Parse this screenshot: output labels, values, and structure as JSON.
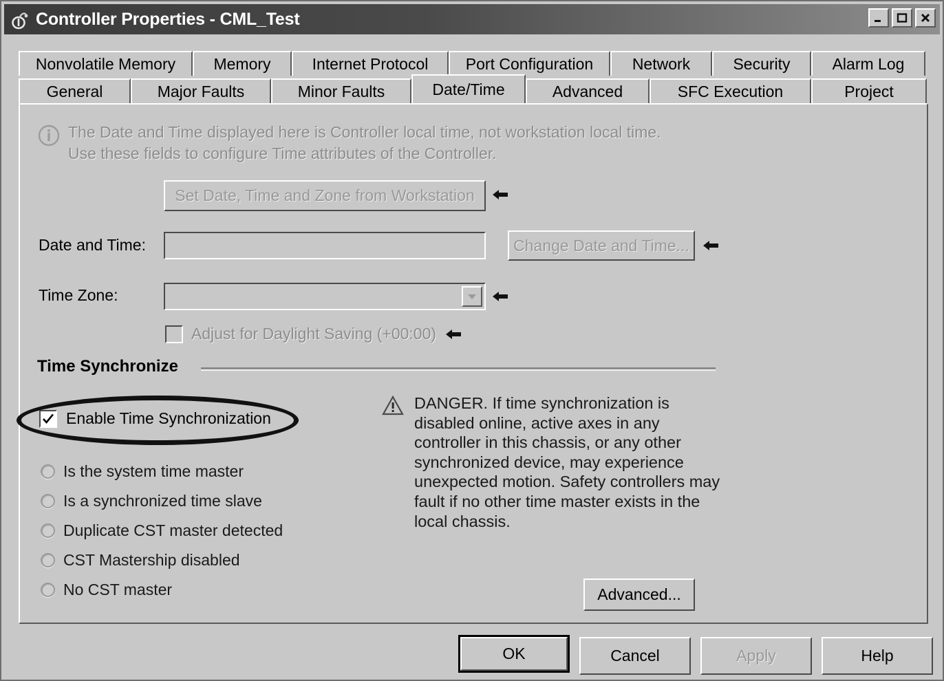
{
  "window": {
    "title": "Controller Properties - CML_Test",
    "icon": "controller-icon",
    "controls": {
      "minimize": "minimize-icon",
      "maximize": "maximize-icon",
      "close": "close-icon"
    }
  },
  "tabs": {
    "row1": [
      {
        "label": "Nonvolatile Memory",
        "selected": false
      },
      {
        "label": "Memory",
        "selected": false
      },
      {
        "label": "Internet Protocol",
        "selected": false
      },
      {
        "label": "Port Configuration",
        "selected": false
      },
      {
        "label": "Network",
        "selected": false
      },
      {
        "label": "Security",
        "selected": false
      },
      {
        "label": "Alarm Log",
        "selected": false
      }
    ],
    "row2": [
      {
        "label": "General",
        "selected": false
      },
      {
        "label": "Major Faults",
        "selected": false
      },
      {
        "label": "Minor Faults",
        "selected": false
      },
      {
        "label": "Date/Time",
        "selected": true
      },
      {
        "label": "Advanced",
        "selected": false
      },
      {
        "label": "SFC Execution",
        "selected": false
      },
      {
        "label": "Project",
        "selected": false
      }
    ]
  },
  "datetime_tab": {
    "info": {
      "icon": "info-icon",
      "line1": "The Date and Time displayed here is Controller local time, not workstation local time.",
      "line2": "Use these fields to configure Time attributes of the Controller."
    },
    "set_from_workstation_button": "Set Date, Time and Zone from Workstation",
    "date_and_time_label": "Date and Time:",
    "date_and_time_value": "",
    "change_date_time_button": "Change Date and Time...",
    "time_zone_label": "Time Zone:",
    "time_zone_value": "",
    "daylight_saving_label": "Adjust for Daylight Saving (+00:00)",
    "daylight_saving_checked": false,
    "time_sync": {
      "group_title": "Time Synchronize",
      "enable_label": "Enable Time Synchronization",
      "enable_checked": true,
      "status_options": [
        "Is the system time master",
        "Is a synchronized time slave",
        "Duplicate CST master detected",
        "CST Mastership disabled",
        "No CST master"
      ]
    },
    "danger": {
      "icon": "warning-triangle-icon",
      "lines": [
        "DANGER. If time synchronization is",
        "disabled online, active axes in any",
        "controller in this chassis, or any other",
        "synchronized device, may experience",
        "unexpected motion.  Safety controllers may",
        "fault if no other time master exists in the",
        "local chassis."
      ]
    },
    "advanced_button": "Advanced..."
  },
  "footer": {
    "ok": "OK",
    "cancel": "Cancel",
    "apply": "Apply",
    "apply_disabled": true,
    "help": "Help"
  },
  "annotations": {
    "ellipse_target": "Enable Time Synchronization",
    "arrow_icon": "left-arrow-annotation"
  },
  "colors": {
    "face": "#c8c8c8",
    "titlebar_dark": "#3a3a3a",
    "text": "#000000",
    "disabled_text": "#8d8d8d",
    "annotation": "#111111"
  }
}
